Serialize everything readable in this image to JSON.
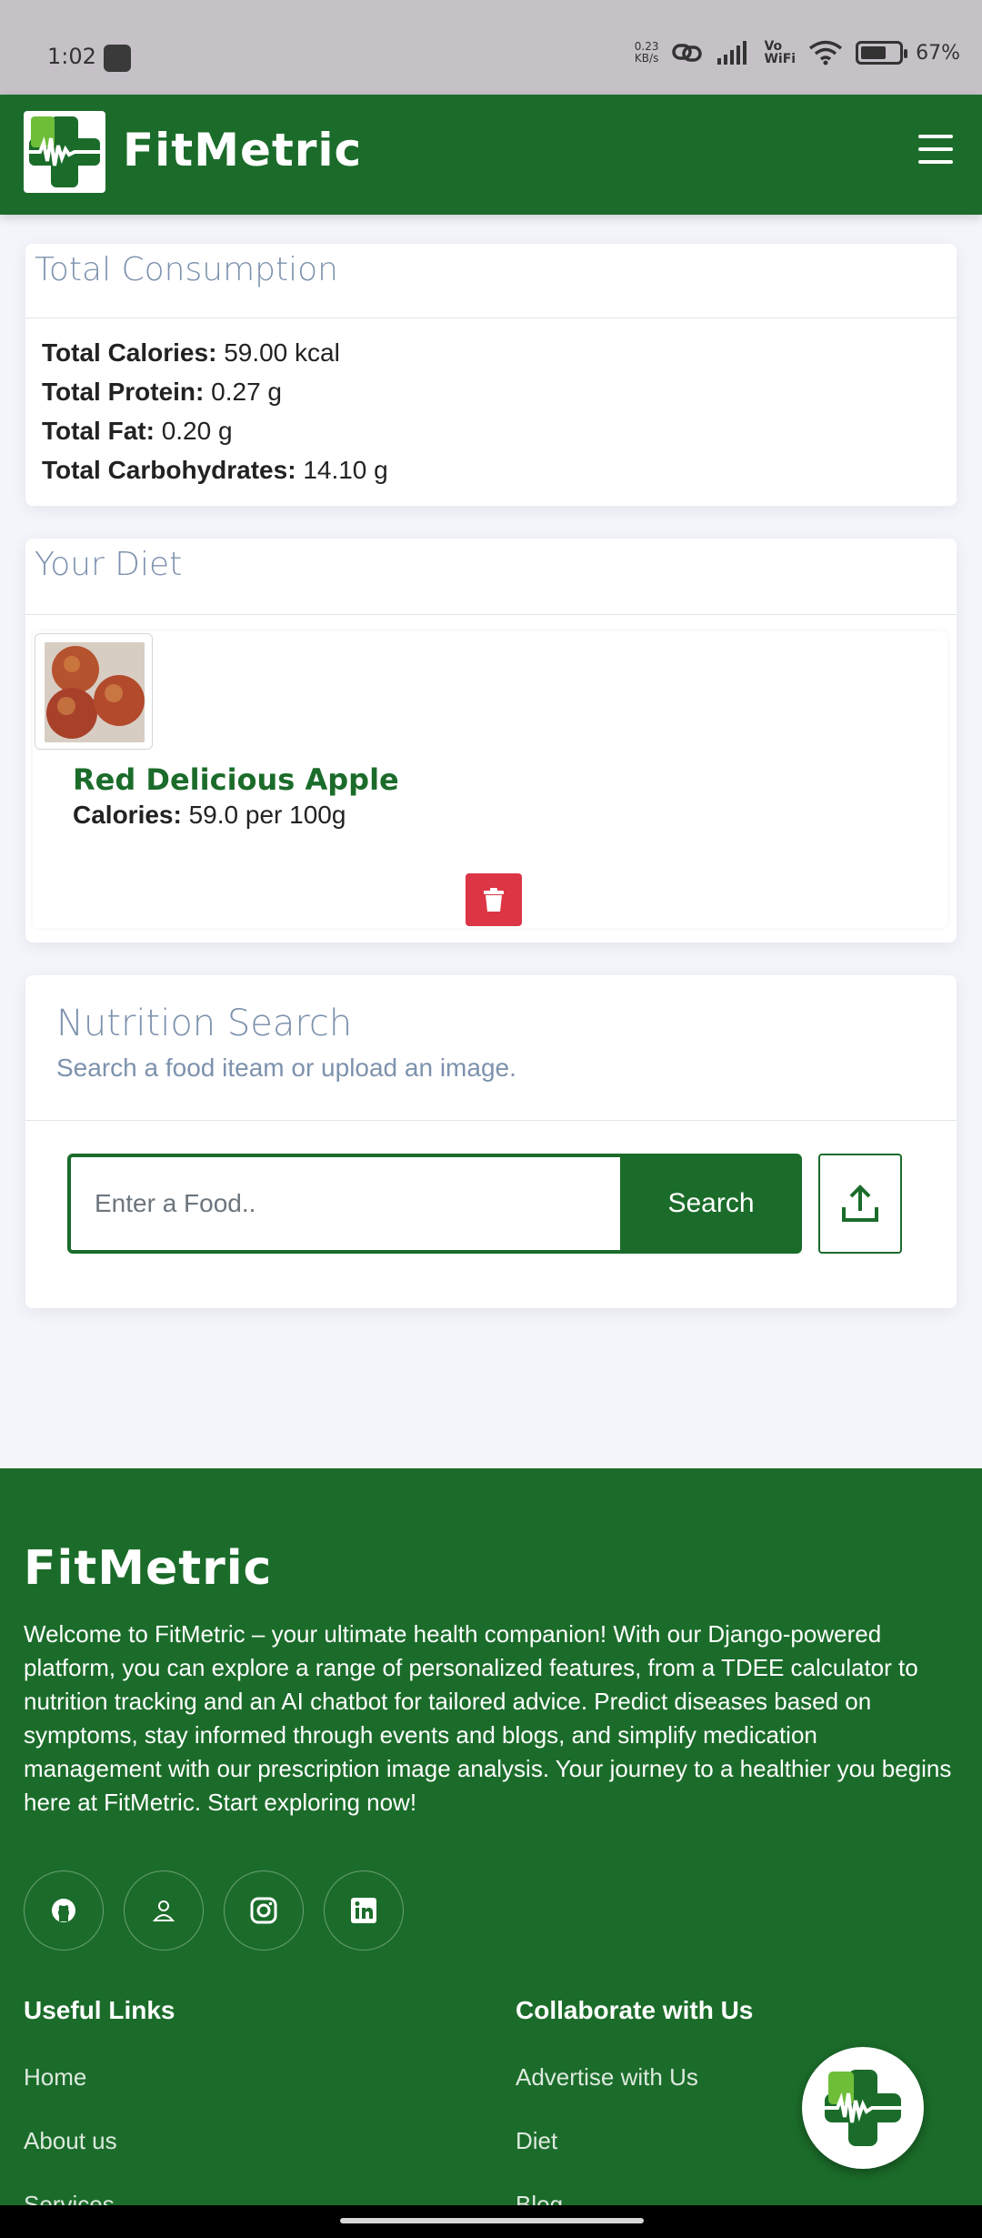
{
  "status_bar": {
    "time": "1:02",
    "net_speed_value": "0.23",
    "net_speed_unit": "KB/s",
    "vowifi_top": "Vo",
    "vowifi_bottom": "WiFi",
    "battery_level": 0.67,
    "battery": "67%"
  },
  "navbar": {
    "brand": "FitMetric"
  },
  "total_consumption": {
    "title": "Total Consumption",
    "items": [
      {
        "label": "Total Calories:",
        "value": "59.00 kcal"
      },
      {
        "label": "Total Protein:",
        "value": "0.27 g"
      },
      {
        "label": "Total Fat:",
        "value": "0.20 g"
      },
      {
        "label": "Total Carbohydrates:",
        "value": "14.10 g"
      }
    ]
  },
  "diet": {
    "title": "Your Diet",
    "items": [
      {
        "name": "Red Delicious Apple",
        "calories_label": "Calories:",
        "calories_value": "59.0 per 100g"
      }
    ]
  },
  "nutrition_search": {
    "title": "Nutrition Search",
    "subtitle": "Search a food iteam or upload an image.",
    "placeholder": "Enter a Food..",
    "value": "",
    "search_label": "Search"
  },
  "footer": {
    "brand": "FitMetric",
    "description": "Welcome to FitMetric – your ultimate health companion! With our Django-powered platform, you can explore a range of personalized features, from a TDEE calculator to nutrition tracking and an AI chatbot for tailored advice. Predict diseases based on symptoms, stay informed through events and blogs, and simplify medication management with our prescription image analysis. Your journey to a healthier you begins here at FitMetric. Start exploring now!",
    "social_icons": [
      "github-icon",
      "person-icon",
      "instagram-icon",
      "linkedin-icon"
    ],
    "useful_links": {
      "heading": "Useful Links",
      "links": [
        "Home",
        "About us",
        "Services"
      ]
    },
    "collaborate": {
      "heading": "Collaborate with Us",
      "links": [
        "Advertise with Us",
        "Diet",
        "Blog"
      ]
    }
  },
  "colors": {
    "brand_green": "#1b6c2a",
    "title_blue_gray": "#7d92ae",
    "danger": "#dc3545"
  }
}
